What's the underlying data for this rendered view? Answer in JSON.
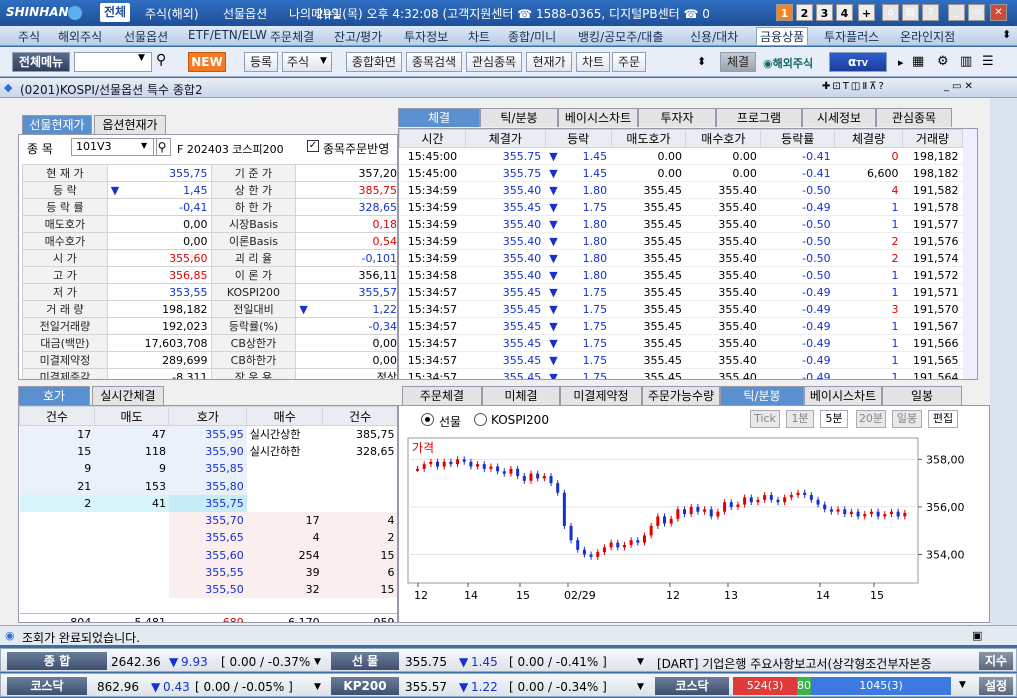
{
  "titlebar": {
    "logo": "SHINHAN",
    "menus": [
      "전체",
      "주식(해외)",
      "선물옵션",
      "나의메뉴1"
    ],
    "info": "29일(목) 오후 4:32:08 (고객지원센터 ☎ 1588-0365, 디지털PB센터 ☎ 0",
    "num_buttons": [
      "1",
      "2",
      "3",
      "4",
      "+"
    ]
  },
  "menubar": [
    "주식",
    "해외주식",
    "선물옵션",
    "ETF/ETN/ELW",
    "주문체결",
    "잔고/평가",
    "투자정보",
    "차트",
    "종합/미니",
    "뱅킹/공모주/대출",
    "신용/대차",
    "금융상품",
    "투자플러스",
    "온라인지점"
  ],
  "toolbar": {
    "all_menu": "전체메뉴",
    "new": "NEW",
    "register": "등록",
    "stock_select": "주식",
    "buttons": [
      "종합화면",
      "종목검색",
      "관심종목",
      "현재가",
      "차트",
      "주문"
    ],
    "conclusion": "체결",
    "overseas": "해외주식"
  },
  "window": {
    "title": "(0201)KOSPI/선물옵션 특수 종합2"
  },
  "quote": {
    "tabs": [
      "선물현재가",
      "옵션현재가"
    ],
    "code_label": "종 목",
    "code": "101V3",
    "name": "F 202403 코스피200",
    "check_label": "종목주문반영",
    "rows": [
      {
        "l1": "현 재 가",
        "v1": "355,75",
        "l2": "기 준 가",
        "v2": "357,20"
      },
      {
        "l1": "등   락",
        "v1": "1,45",
        "l2": "상 한 가",
        "v2": "385,75"
      },
      {
        "l1": "등 락 률",
        "v1": "-0,41",
        "l2": "하 한 가",
        "v2": "328,65"
      },
      {
        "l1": "매도호가",
        "v1": "0,00",
        "l2": "시장Basis",
        "v2": "0,18"
      },
      {
        "l1": "매수호가",
        "v1": "0,00",
        "l2": "이론Basis",
        "v2": "0,54"
      },
      {
        "l1": "시   가",
        "v1": "355,60",
        "l2": "괴 리 율",
        "v2": "-0,101"
      },
      {
        "l1": "고   가",
        "v1": "356,85",
        "l2": "이 론 가",
        "v2": "356,11"
      },
      {
        "l1": "저   가",
        "v1": "353,55",
        "l2": "KOSPI200",
        "v2": "355,57"
      },
      {
        "l1": "거 래 량",
        "v1": "198,182",
        "l2": "전일대비",
        "v2": "1,22"
      },
      {
        "l1": "전일거래량",
        "v1": "192,023",
        "l2": "등락률(%)",
        "v2": "-0,34"
      },
      {
        "l1": "대금(백만)",
        "v1": "17,603,708",
        "l2": "CB상한가",
        "v2": "0,00"
      },
      {
        "l1": "미결제약정",
        "v1": "289,699",
        "l2": "CB하한가",
        "v2": "0,00"
      },
      {
        "l1": "미결제증감",
        "v1": "-8,311",
        "l2": "장 운 용",
        "v2": "정상"
      }
    ]
  },
  "ticks": {
    "tabs": [
      "체결",
      "틱/분봉",
      "베이시스차트",
      "투자자",
      "프로그램",
      "시세정보",
      "관심종목"
    ],
    "headers": [
      "시간",
      "체결가",
      "등락",
      "매도호가",
      "매수호가",
      "등락률",
      "체결량",
      "거래량"
    ],
    "rows": [
      [
        "15:45:00",
        "355.75",
        "1.45",
        "0.00",
        "0.00",
        "-0.41",
        "0",
        "198,182"
      ],
      [
        "15:45:00",
        "355.75",
        "1.45",
        "0.00",
        "0.00",
        "-0.41",
        "6,600",
        "198,182"
      ],
      [
        "15:34:59",
        "355.40",
        "1.80",
        "355.45",
        "355.40",
        "-0.50",
        "4",
        "191,582"
      ],
      [
        "15:34:59",
        "355.45",
        "1.75",
        "355.45",
        "355.40",
        "-0.49",
        "1",
        "191,578"
      ],
      [
        "15:34:59",
        "355.40",
        "1.80",
        "355.45",
        "355.40",
        "-0.50",
        "1",
        "191,577"
      ],
      [
        "15:34:59",
        "355.40",
        "1.80",
        "355.45",
        "355.40",
        "-0.50",
        "2",
        "191,576"
      ],
      [
        "15:34:59",
        "355.40",
        "1.80",
        "355.45",
        "355.40",
        "-0.50",
        "2",
        "191,574"
      ],
      [
        "15:34:58",
        "355.40",
        "1.80",
        "355.45",
        "355.40",
        "-0.50",
        "1",
        "191,572"
      ],
      [
        "15:34:57",
        "355.45",
        "1.75",
        "355.45",
        "355.40",
        "-0.49",
        "1",
        "191,571"
      ],
      [
        "15:34:57",
        "355.45",
        "1.75",
        "355.45",
        "355.40",
        "-0.49",
        "3",
        "191,570"
      ],
      [
        "15:34:57",
        "355.45",
        "1.75",
        "355.45",
        "355.40",
        "-0.49",
        "1",
        "191,567"
      ],
      [
        "15:34:57",
        "355.45",
        "1.75",
        "355.45",
        "355.40",
        "-0.49",
        "1",
        "191,566"
      ],
      [
        "15:34:57",
        "355.45",
        "1.75",
        "355.45",
        "355.40",
        "-0.49",
        "1",
        "191,565"
      ],
      [
        "15:34:57",
        "355.45",
        "1.75",
        "355.45",
        "355.40",
        "-0.49",
        "1",
        "191,564"
      ]
    ]
  },
  "orderbook": {
    "tabs": [
      "호가",
      "실시간체결"
    ],
    "headers": [
      "건수",
      "매도",
      "호가",
      "매수",
      "건수"
    ],
    "sell": [
      [
        "17",
        "47",
        "355,95"
      ],
      [
        "15",
        "118",
        "355,90"
      ],
      [
        "9",
        "9",
        "355,85"
      ],
      [
        "21",
        "153",
        "355,80"
      ],
      [
        "2",
        "41",
        "355,75"
      ]
    ],
    "buy": [
      [
        "355,70",
        "17",
        "4"
      ],
      [
        "355,65",
        "4",
        "2"
      ],
      [
        "355,60",
        "254",
        "15"
      ],
      [
        "355,55",
        "39",
        "6"
      ],
      [
        "355,50",
        "32",
        "15"
      ]
    ],
    "upper_label": "실시간상한",
    "upper": "385,75",
    "lower_label": "실시간하한",
    "lower": "328,65",
    "totals": [
      "804",
      "5,481",
      "689",
      "6,170",
      "959"
    ]
  },
  "chart": {
    "tabs": [
      "주문체결",
      "미체결",
      "미결제약정",
      "주문가능수량",
      "틱/분봉",
      "베이시스차트",
      "일봉"
    ],
    "radio": [
      "선물",
      "KOSPI200"
    ],
    "buttons": [
      "Tick",
      "1분",
      "5분",
      "20분",
      "일봉",
      "편집"
    ],
    "label": "가격",
    "x_ticks": [
      "12",
      "14",
      "15",
      "02/29",
      "12",
      "13",
      "14",
      "15"
    ]
  },
  "chart_data": {
    "type": "candlestick",
    "title": "가격",
    "yticks": [
      "358,00",
      "356,00",
      "354,00"
    ],
    "ylim": [
      352.8,
      358.9
    ],
    "values": [
      357.6,
      357.8,
      357.9,
      357.7,
      357.9,
      357.8,
      358.0,
      357.9,
      357.7,
      357.8,
      357.6,
      357.7,
      357.5,
      357.4,
      357.6,
      357.3,
      357.1,
      357.4,
      357.2,
      357.3,
      357.0,
      356.6,
      355.2,
      354.6,
      354.2,
      354.0,
      353.9,
      354.1,
      354.3,
      354.5,
      354.3,
      354.4,
      354.6,
      354.5,
      354.8,
      355.2,
      355.6,
      355.3,
      355.5,
      355.9,
      355.7,
      356.0,
      355.8,
      355.9,
      355.6,
      355.8,
      356.2,
      356.0,
      356.1,
      356.4,
      356.2,
      356.3,
      356.5,
      356.3,
      356.2,
      356.4,
      356.5,
      356.6,
      356.5,
      356.3,
      356.1,
      355.9,
      355.8,
      355.9,
      355.7,
      355.8,
      355.6,
      355.7,
      355.8,
      355.6,
      355.7,
      355.8,
      355.6,
      355.75
    ]
  },
  "status": {
    "message": "조회가 완료되었습니다."
  },
  "bottom": {
    "r1": {
      "a": "종 합",
      "b": "2642.36",
      "c": "9.93",
      "d": "[ 0.00  / -0.37% ]",
      "e": "선 물",
      "f": "355.75",
      "g": "1.45",
      "h": "[ 0.00  / -0.41% ]",
      "news": "[DART] 기업은행 주요사항보고서(상각형조건부자본증",
      "btn": "지수"
    },
    "r2": {
      "a": "코스닥",
      "b": "862.96",
      "c": "0.43",
      "d": "[ 0.00  / -0.05% ]",
      "e": "KP200",
      "f": "355.57",
      "g": "1.22",
      "h": "[ 0.00  / -0.34% ]",
      "i": "코스닥",
      "sell": "524(3)",
      "mid": "80",
      "buy": "1045(3)",
      "btn": "설정"
    }
  },
  "colors": {
    "accent": "#1f4f98",
    "up": "#e00000",
    "down": "#1530d0"
  }
}
